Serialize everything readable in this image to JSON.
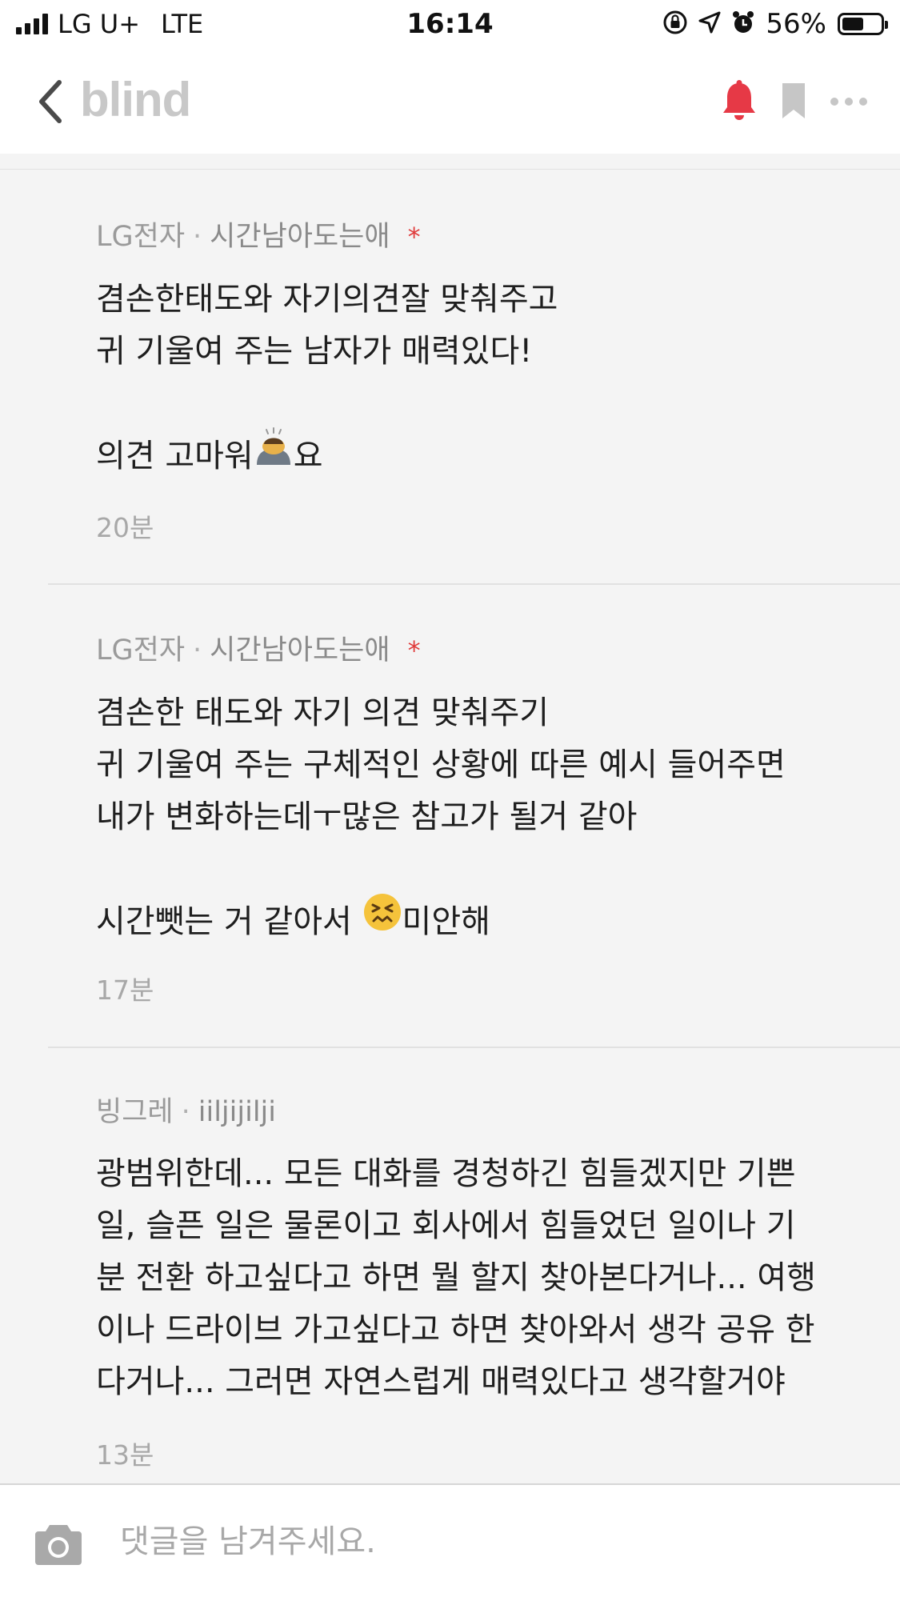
{
  "status_bar": {
    "carrier": "LG U+",
    "network": "LTE",
    "time": "16:14",
    "battery_percent_label": "56%",
    "battery_level": 0.56,
    "icons": [
      "signal-icon",
      "orientation-lock-icon",
      "location-icon",
      "alarm-icon",
      "battery-icon"
    ]
  },
  "nav": {
    "logo": "blind",
    "icons": [
      "back-icon",
      "bell-icon",
      "bookmark-icon",
      "more-icon"
    ],
    "colors": {
      "bell": "#e63946",
      "logo": "#c8c8c8",
      "icon_gray": "#c6c6c6"
    }
  },
  "comments": [
    {
      "company": "LG전자",
      "nickname": "시간남아도는애",
      "author_badge": "*",
      "lines": [
        "겸손한태도와 자기의견잘 맞춰주고",
        "귀 기울여 주는 남자가 매력있다!",
        "",
        "의견 고마워"
      ],
      "line4_suffix": "요",
      "emoji": "person-bowing-emoji",
      "time": "20분"
    },
    {
      "company": "LG전자",
      "nickname": "시간남아도는애",
      "author_badge": "*",
      "lines": [
        "겸손한 태도와 자기 의견 맞춰주기",
        "귀 기울여 주는 구체적인 상황에 따른 예시 들어주면",
        "내가 변화하는데ㅜ많은 참고가 될거 같아",
        "",
        "시간뺏는 거 같아서 "
      ],
      "line5_suffix": "미안해",
      "emoji": "confounded-face-emoji",
      "time": "17분"
    },
    {
      "company": "빙그레",
      "nickname": "iiljijilji",
      "lines": [
        "광범위한데... 모든 대화를 경청하긴 힘들겠지만 기쁜",
        "일, 슬픈 일은 물론이고 회사에서 힘들었던 일이나 기",
        "분 전환 하고싶다고 하면 뭘 할지 찾아본다거나... 여행",
        "이나 드라이브 가고싶다고 하면 찾아와서 생각 공유 한",
        "다거나... 그러면 자연스럽게 매력있다고 생각할거야"
      ],
      "time": "13분"
    }
  ],
  "input": {
    "placeholder": "댓글을 남겨주세요.",
    "value": "",
    "icon": "camera-icon"
  }
}
